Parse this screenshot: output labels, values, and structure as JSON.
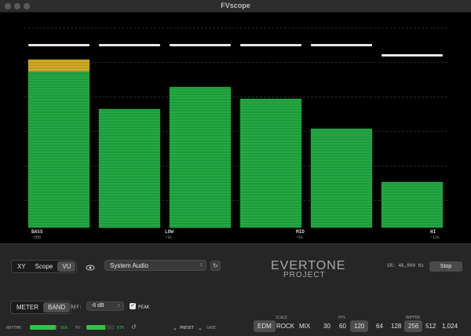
{
  "window": {
    "title": "FVscope"
  },
  "meter": {
    "bands": [
      {
        "name": "BASS",
        "freq": "~300",
        "level": 0.79,
        "hot_level": 0.06,
        "peak": 0.9
      },
      {
        "name": "",
        "freq": "",
        "level": 0.6,
        "hot_level": 0,
        "peak": 0.9
      },
      {
        "name": "LOW",
        "freq": "~1k",
        "level": 0.71,
        "hot_level": 0,
        "peak": 0.9
      },
      {
        "name": "",
        "freq": "",
        "level": 0.65,
        "hot_level": 0,
        "peak": 0.9
      },
      {
        "name": "MID",
        "freq": "~5k",
        "level": 0.5,
        "hot_level": 0,
        "peak": 0.9
      },
      {
        "name": "HI",
        "freq": "~12k",
        "level": 0.23,
        "hot_level": 0,
        "peak": 0.85
      }
    ]
  },
  "controls": {
    "view_modes": [
      "XY",
      "Scope",
      "VU"
    ],
    "view_selected": "VU",
    "audio_source": "System Audio",
    "display_modes": [
      "METER",
      "BAND"
    ],
    "display_selected": "BAND",
    "ref_label": "REF:",
    "ref_value": "-6 dB",
    "peak_label": "PEAK",
    "peak_checked": true,
    "rhythm_label": "RHYTHM:",
    "rhythm_value": 0.91,
    "rhythm_text": "91%",
    "fv_label": "FV:",
    "fv_value": 0.67,
    "fv_text": "67%",
    "preset_label": "PRESET",
    "save_label": "SAVE",
    "scale_label": "SCALE",
    "scale_options": [
      "EDM",
      "ROCK",
      "MIX"
    ],
    "scale_selected": "EDM",
    "fps_label": "FPS",
    "fps_options": [
      "30",
      "60",
      "120"
    ],
    "fps_selected": "120",
    "buffer_label": "BUFFER",
    "buffer_options": [
      "64",
      "128",
      "256",
      "512",
      "1,024"
    ],
    "buffer_selected": "256"
  },
  "branding": {
    "logo_line1": "EVERTONE",
    "logo_line2": "PROJECT"
  },
  "status": {
    "sample_rate": "SR: 48,000 Hz",
    "stop_label": "Stop"
  },
  "icons": {
    "eye": "eye-icon",
    "refresh": "refresh-icon",
    "reset": "reset-icon",
    "chevron": "chevron-down-icon",
    "updown": "updown-arrows-icon"
  }
}
